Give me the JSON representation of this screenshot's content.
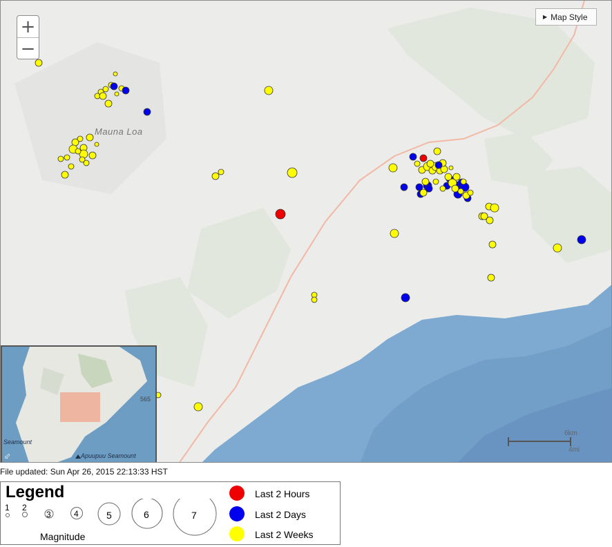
{
  "map": {
    "zoom_in": "+",
    "zoom_out": "−",
    "map_style_label": "Map Style",
    "place_label": "Mauna Loa",
    "inset_labels": {
      "left": "Seamount",
      "right": "Apuupuu Seamount",
      "coast": "565"
    },
    "scale": {
      "km": "6km",
      "mi": "4mi"
    },
    "colors": {
      "last_2_hours": "#ee0000",
      "last_2_days": "#0000ee",
      "last_2_weeks": "#ffff00",
      "ocean": "#7ea9d0",
      "land": "#ececea",
      "road": "#f3b8a4"
    }
  },
  "footer": {
    "file_updated": "File updated: Sun Apr 26, 2015 22:13:33 HST"
  },
  "legend": {
    "title": "Legend",
    "magnitudes": [
      "1",
      "2",
      "3",
      "4",
      "5",
      "6",
      "7"
    ],
    "magnitude_label": "Magnitude",
    "entries": [
      {
        "label": "Last 2 Hours",
        "color": "#ee0000"
      },
      {
        "label": "Last 2 Days",
        "color": "#0000ee"
      },
      {
        "label": "Last 2 Weeks",
        "color": "#ffff00"
      }
    ]
  }
}
